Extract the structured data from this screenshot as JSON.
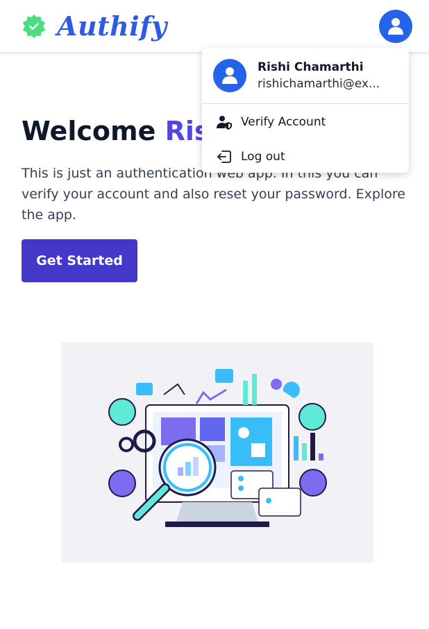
{
  "brand": {
    "name": "Authify",
    "accent_color": "#2f5be3",
    "badge_color": "#4ade80"
  },
  "navbar": {
    "avatar_icon": "user-icon"
  },
  "hero": {
    "title_prefix": "Welcome ",
    "title_name": "Rishi",
    "description": "This is just an authentication web app. In this you can verify your account and also reset your password. Explore the app.",
    "cta_label": "Get Started"
  },
  "dropdown": {
    "user_name": "Rishi Chamarthi",
    "user_email": "rishichamarthi@ex...",
    "items": [
      {
        "label": "Verify Account",
        "icon": "user-shield-icon"
      },
      {
        "label": "Log out",
        "icon": "logout-icon"
      }
    ]
  },
  "colors": {
    "primary": "#4338ca",
    "avatar": "#2563eb",
    "title_accent": "#4f46e5"
  }
}
